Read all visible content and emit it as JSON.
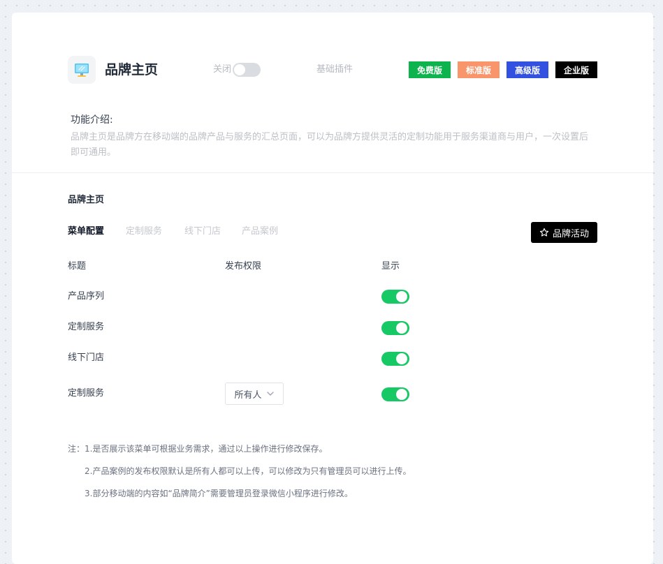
{
  "header": {
    "title": "品牌主页",
    "toggle_label": "关闭",
    "toggle_on": false,
    "plugin_type": "基础插件",
    "app_icon": "monitor-icon",
    "editions": [
      {
        "label": "免费版",
        "color": "#0db34d"
      },
      {
        "label": "标准版",
        "color": "#f9956a"
      },
      {
        "label": "高级版",
        "color": "#3351e0"
      },
      {
        "label": "企业版",
        "color": "#000000"
      }
    ]
  },
  "intro": {
    "heading": "功能介绍:",
    "text": "品牌主页是品牌方在移动端的品牌产品与服务的汇总页面，可以为品牌方提供灵活的定制功能用于服务渠道商与用户，一次设置后即可通用。"
  },
  "section": {
    "title": "品牌主页",
    "tabs": [
      "菜单配置",
      "定制服务",
      "线下门店",
      "产品案例"
    ],
    "active_tab": "菜单配置",
    "action_button": "品牌活动",
    "action_icon": "star-icon"
  },
  "table": {
    "headers": [
      "标题",
      "发布权限",
      "显示"
    ],
    "rows": [
      {
        "title": "产品序列",
        "permission": "",
        "visible": true
      },
      {
        "title": "定制服务",
        "permission": "",
        "visible": true
      },
      {
        "title": "线下门店",
        "permission": "",
        "visible": true
      },
      {
        "title": "定制服务",
        "permission": "所有人",
        "visible": true
      }
    ]
  },
  "notes": [
    "注：1.是否展示该菜单可根据业务需求，通过以上操作进行修改保存。",
    "2.产品案例的发布权限默认是所有人都可以上传，可以修改为只有管理员可以进行上传。",
    "3.部分移动端的内容如“品牌简介”需要管理员登录微信小程序进行修改。"
  ]
}
